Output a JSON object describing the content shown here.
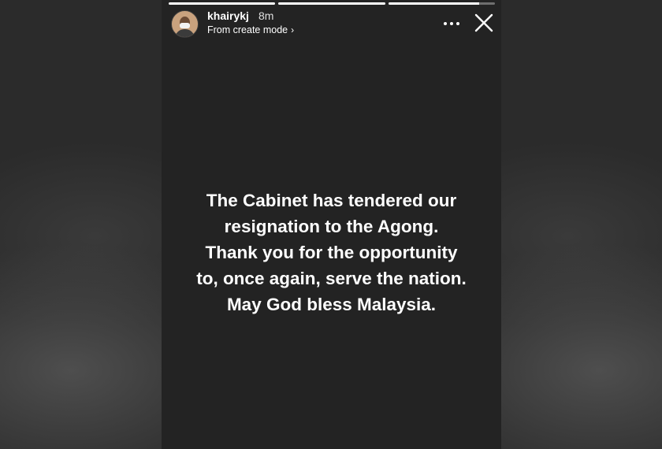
{
  "story": {
    "progress": [
      1,
      1,
      0.85
    ],
    "user": {
      "username": "khairykj",
      "time_ago": "8m",
      "subtitle": "From create mode",
      "subtitle_chevron": "›"
    },
    "icons": {
      "more": "more-options-icon",
      "close": "close-icon",
      "avatar": "profile-avatar"
    },
    "message_lines": [
      "The Cabinet has tendered our",
      "resignation to the Agong.",
      "Thank you for the opportunity",
      "to, once again, serve the nation.",
      "May God bless Malaysia."
    ]
  }
}
